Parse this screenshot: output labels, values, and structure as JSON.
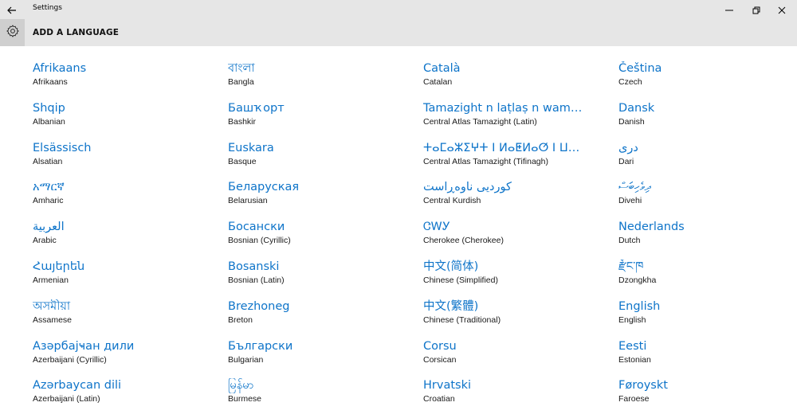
{
  "window": {
    "title": "Settings",
    "icons": {
      "back": "back-arrow-icon",
      "minimize": "minimize-icon",
      "restore": "restore-icon",
      "close": "close-icon"
    }
  },
  "header": {
    "title": "ADD A LANGUAGE",
    "icon": "gear-icon"
  },
  "colors": {
    "accent": "#0e74c9",
    "chrome": "#e6e6e6",
    "gear_bg": "#cfcfcf"
  },
  "languages": [
    {
      "native": "Afrikaans",
      "english": "Afrikaans"
    },
    {
      "native": "বাংলা",
      "english": "Bangla"
    },
    {
      "native": "Català",
      "english": "Catalan"
    },
    {
      "native": "Čeština",
      "english": "Czech"
    },
    {
      "native": "Shqip",
      "english": "Albanian"
    },
    {
      "native": "Башҡорт",
      "english": "Bashkir"
    },
    {
      "native": "Tamazight n laṭlaṣ n wammas",
      "english": "Central Atlas Tamazight (Latin)"
    },
    {
      "native": "Dansk",
      "english": "Danish"
    },
    {
      "native": "Elsässisch",
      "english": "Alsatian"
    },
    {
      "native": "Euskara",
      "english": "Basque"
    },
    {
      "native": "ⵜⴰⵎⴰⵣⵉⵖⵜ ⵏ ⵍⴰⵟⵍⴰⵚ ⵏ ⵡⴰⵎⵎⴰⵙ",
      "english": "Central Atlas Tamazight (Tifinagh)"
    },
    {
      "native": "درى",
      "english": "Dari"
    },
    {
      "native": "አማርኛ",
      "english": "Amharic"
    },
    {
      "native": "Беларуская",
      "english": "Belarusian"
    },
    {
      "native": "کوردیی ناوەڕاست",
      "english": "Central Kurdish"
    },
    {
      "native": "ދިވެހިބަސް",
      "english": "Divehi"
    },
    {
      "native": "العربية",
      "english": "Arabic"
    },
    {
      "native": "Босански",
      "english": "Bosnian (Cyrillic)"
    },
    {
      "native": "ᏣᎳᎩ",
      "english": "Cherokee (Cherokee)"
    },
    {
      "native": "Nederlands",
      "english": "Dutch"
    },
    {
      "native": "Հայերեն",
      "english": "Armenian"
    },
    {
      "native": "Bosanski",
      "english": "Bosnian (Latin)"
    },
    {
      "native": "中文(简体)",
      "english": "Chinese (Simplified)"
    },
    {
      "native": "རྫོང་ཁ",
      "english": "Dzongkha"
    },
    {
      "native": "অসমীয়া",
      "english": "Assamese"
    },
    {
      "native": "Brezhoneg",
      "english": "Breton"
    },
    {
      "native": "中文(繁體)",
      "english": "Chinese (Traditional)"
    },
    {
      "native": "English",
      "english": "English"
    },
    {
      "native": "Азәрбајҹан дили",
      "english": "Azerbaijani (Cyrillic)"
    },
    {
      "native": "Български",
      "english": "Bulgarian"
    },
    {
      "native": "Corsu",
      "english": "Corsican"
    },
    {
      "native": "Eesti",
      "english": "Estonian"
    },
    {
      "native": "Azərbaycan dili",
      "english": "Azerbaijani (Latin)"
    },
    {
      "native": "မြန်မာ",
      "english": "Burmese"
    },
    {
      "native": "Hrvatski",
      "english": "Croatian"
    },
    {
      "native": "Føroyskt",
      "english": "Faroese"
    }
  ]
}
